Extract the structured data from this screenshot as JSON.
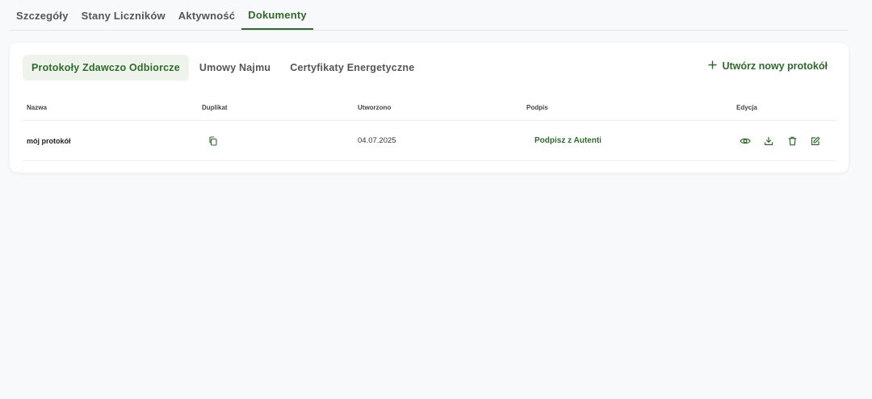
{
  "top_tabs": [
    {
      "label": "Szczegóły",
      "active": false
    },
    {
      "label": "Stany Liczników",
      "active": false
    },
    {
      "label": "Aktywność",
      "active": false
    },
    {
      "label": "Dokumenty",
      "active": true
    }
  ],
  "sub_tabs": [
    {
      "label": "Protokoły Zdawczo Odbiorcze",
      "active": true
    },
    {
      "label": "Umowy Najmu",
      "active": false
    },
    {
      "label": "Certyfikaty Energetyczne",
      "active": false
    }
  ],
  "new_button": {
    "label": "Utwórz nowy protokół",
    "icon": "plus-icon"
  },
  "table": {
    "headers": {
      "name": "Nazwa",
      "duplicate": "Duplikat",
      "created": "Utworzono",
      "signature": "Podpis",
      "edit": "Edycja"
    },
    "rows": [
      {
        "name": "mój protokół",
        "created": "04.07.2025",
        "signature_action": "Podpisz z Autenti",
        "duplicate_icon": "copy-icon",
        "edit_icons": [
          "eye-icon",
          "download-icon",
          "trash-icon",
          "edit-icon"
        ]
      }
    ]
  },
  "colors": {
    "accent": "#2e6b2a",
    "active_tab_bg": "#eef4ec",
    "page_bg": "#f8f9fa"
  }
}
